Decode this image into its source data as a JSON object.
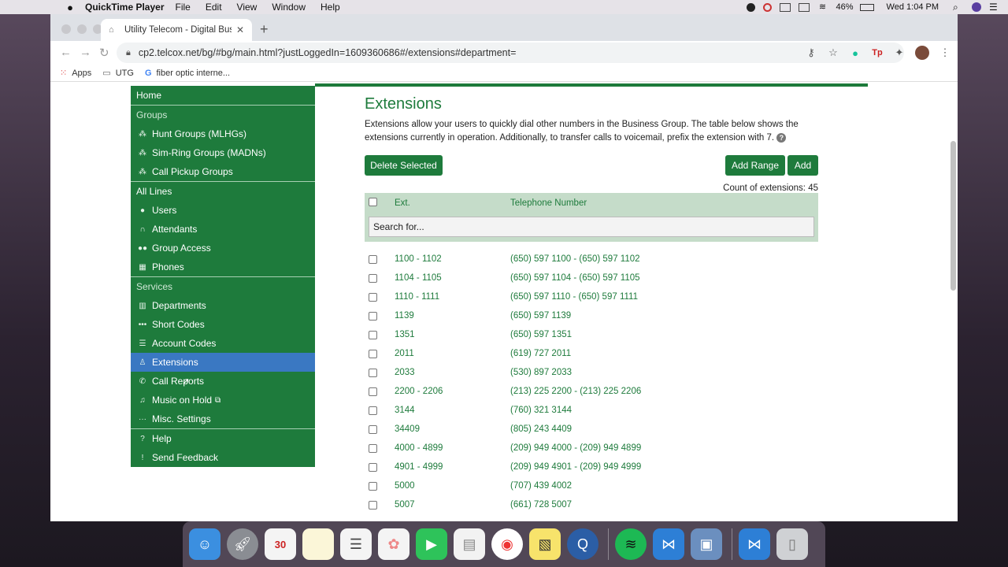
{
  "menubar": {
    "app_name": "QuickTime Player",
    "menus": [
      "File",
      "Edit",
      "View",
      "Window",
      "Help"
    ],
    "battery": "46%",
    "clock": "Wed 1:04 PM"
  },
  "browser": {
    "tab_title": "Utility Telecom - Digital Busine",
    "url": "cp2.telcox.net/bg/#bg/main.html?justLoggedIn=1609360686#/extensions#department=",
    "bookmarks": [
      "Apps",
      "UTG",
      "fiber optic interne..."
    ]
  },
  "sidebar": {
    "home": "Home",
    "groups_head": "Groups",
    "groups": [
      {
        "label": "Hunt Groups (MLHGs)",
        "icon": "org-chart-icon"
      },
      {
        "label": "Sim-Ring Groups (MADNs)",
        "icon": "org-chart-icon"
      },
      {
        "label": "Call Pickup Groups",
        "icon": "org-chart-icon"
      }
    ],
    "all_lines_head": "All Lines",
    "lines": [
      {
        "label": "Users",
        "icon": "user-icon"
      },
      {
        "label": "Attendants",
        "icon": "headset-icon"
      },
      {
        "label": "Group Access",
        "icon": "group-icon"
      },
      {
        "label": "Phones",
        "icon": "phone-icon"
      }
    ],
    "services_head": "Services",
    "services": [
      {
        "label": "Departments",
        "icon": "building-icon"
      },
      {
        "label": "Short Codes",
        "icon": "dots-icon"
      },
      {
        "label": "Account Codes",
        "icon": "list-icon"
      },
      {
        "label": "Extensions",
        "icon": "extension-icon"
      },
      {
        "label": "Call Reports",
        "icon": "call-icon"
      },
      {
        "label": "Music on Hold",
        "icon": "music-icon"
      },
      {
        "label": "Misc. Settings",
        "icon": "ellipsis-icon"
      }
    ],
    "help": "Help",
    "feedback": "Send Feedback"
  },
  "main": {
    "title": "Extensions",
    "description": "Extensions allow your users to quickly dial other numbers in the Business Group. The table below shows the extensions currently in operation. Additionally, to transfer calls to voicemail, prefix the extension with 7.",
    "delete_label": "Delete Selected",
    "add_range_label": "Add Range",
    "add_label": "Add",
    "count_text": "Count of extensions: 45",
    "col_ext": "Ext.",
    "col_tel": "Telephone Number",
    "search_placeholder": "Search for...",
    "rows": [
      {
        "ext": "1100 - 1102",
        "tel": "(650) 597 1100 - (650) 597 1102"
      },
      {
        "ext": "1104 - 1105",
        "tel": "(650) 597 1104 - (650) 597 1105"
      },
      {
        "ext": "1110 - 1111",
        "tel": "(650) 597 1110 - (650) 597 1111"
      },
      {
        "ext": "1139",
        "tel": "(650) 597 1139"
      },
      {
        "ext": "1351",
        "tel": "(650) 597 1351"
      },
      {
        "ext": "2011",
        "tel": "(619) 727 2011"
      },
      {
        "ext": "2033",
        "tel": "(530) 897 2033"
      },
      {
        "ext": "2200 - 2206",
        "tel": "(213) 225 2200 - (213) 225 2206"
      },
      {
        "ext": "3144",
        "tel": "(760) 321 3144"
      },
      {
        "ext": "34409",
        "tel": "(805) 243 4409"
      },
      {
        "ext": "4000 - 4899",
        "tel": "(209) 949 4000 - (209) 949 4899"
      },
      {
        "ext": "4901 - 4999",
        "tel": "(209) 949 4901 - (209) 949 4999"
      },
      {
        "ext": "5000",
        "tel": "(707) 439 4002"
      },
      {
        "ext": "5007",
        "tel": "(661) 728 5007"
      }
    ]
  },
  "colors": {
    "brand_green": "#1e7b3c",
    "active_blue": "#3a78c2",
    "header_green": "#c5dcc9"
  }
}
